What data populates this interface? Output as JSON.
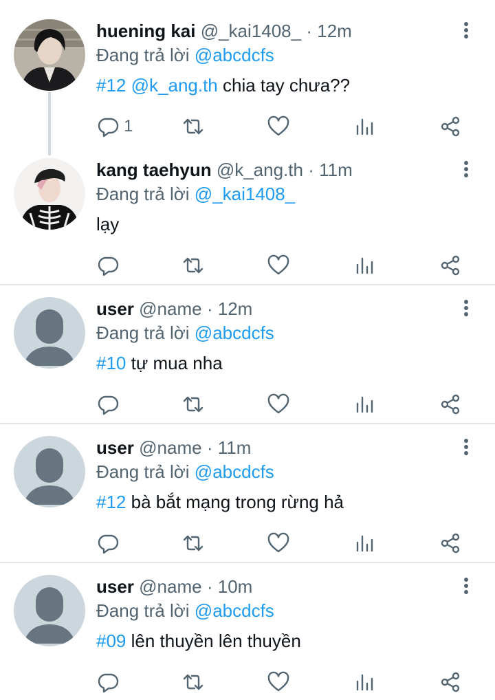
{
  "reply_prefix": "Đang trả lời",
  "tweets": [
    {
      "name": "huening kai",
      "handle": "@_kai1408_",
      "time": "12m",
      "reply_to": "@abcdcfs",
      "tag": "#12",
      "mention": "@k_ang.th",
      "text": "chia tay chưa??",
      "reply_count": "1",
      "avatar": "photo"
    },
    {
      "name": "kang taehyun",
      "handle": "@k_ang.th",
      "time": "11m",
      "reply_to": "@_kai1408_",
      "tag": "",
      "mention": "",
      "text": "lạy",
      "reply_count": "",
      "avatar": "photo"
    },
    {
      "name": "user",
      "handle": "@name",
      "time": "12m",
      "reply_to": "@abcdcfs",
      "tag": "#10",
      "mention": "",
      "text": "tự mua nha",
      "reply_count": "",
      "avatar": "default"
    },
    {
      "name": "user",
      "handle": "@name",
      "time": "11m",
      "reply_to": "@abcdcfs",
      "tag": "#12",
      "mention": "",
      "text": "bà bắt mạng trong rừng hả",
      "reply_count": "",
      "avatar": "default"
    },
    {
      "name": "user",
      "handle": "@name",
      "time": "10m",
      "reply_to": "@abcdcfs",
      "tag": "#09",
      "mention": "",
      "text": "lên thuyền lên thuyền",
      "reply_count": "",
      "avatar": "default"
    }
  ],
  "colors": {
    "link": "#1d9bf0",
    "secondary_text": "#536471",
    "divider": "#e1e6ea",
    "default_avatar_bg": "#ccd6dd",
    "default_avatar_fg": "#66757f"
  },
  "icons": [
    "reply-icon",
    "retweet-icon",
    "like-icon",
    "views-icon",
    "share-icon",
    "more-icon"
  ]
}
